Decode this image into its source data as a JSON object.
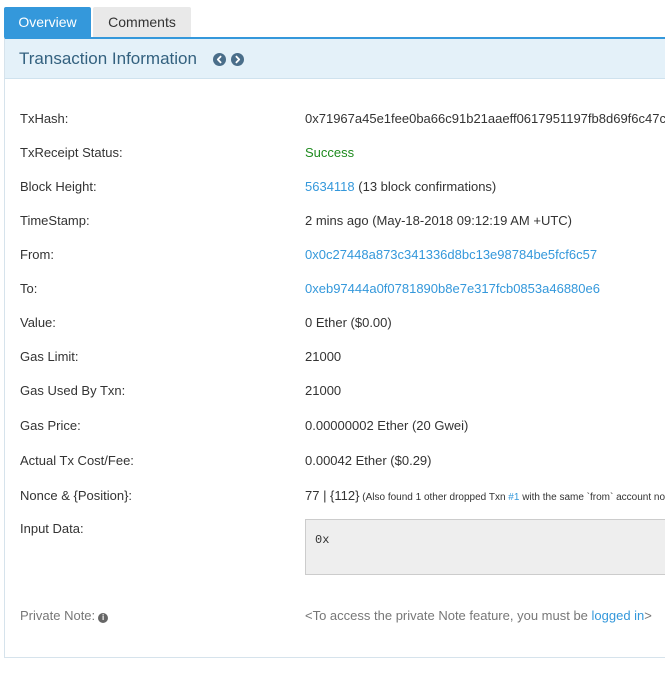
{
  "tabs": [
    {
      "label": "Overview",
      "active": true
    },
    {
      "label": "Comments",
      "active": false
    }
  ],
  "panel": {
    "title": "Transaction Information",
    "prev_icon": "chevron-left-circle-icon",
    "next_icon": "chevron-right-circle-icon"
  },
  "fields": {
    "txhash": {
      "label": "TxHash:",
      "value": "0x71967a45e1fee0ba66c91b21aaeff0617951197fb8d69f6c47c"
    },
    "status": {
      "label": "TxReceipt Status:",
      "value": "Success"
    },
    "block": {
      "label": "Block Height:",
      "block_number": "5634118",
      "confirmations": " (13 block confirmations)"
    },
    "timestamp": {
      "label": "TimeStamp:",
      "value": "2 mins ago (May-18-2018 09:12:19 AM +UTC)"
    },
    "from": {
      "label": "From:",
      "value": "0x0c27448a873c341336d8bc13e98784be5fcf6c57"
    },
    "to": {
      "label": "To:",
      "value": "0xeb97444a0f0781890b8e7e317fcb0853a46880e6"
    },
    "value": {
      "label": "Value:",
      "value": "0 Ether ($0.00)"
    },
    "gas_limit": {
      "label": "Gas Limit:",
      "value": "21000"
    },
    "gas_used": {
      "label": "Gas Used By Txn:",
      "value": "21000"
    },
    "gas_price": {
      "label": "Gas Price:",
      "value": "0.00000002 Ether (20 Gwei)"
    },
    "tx_cost": {
      "label": "Actual Tx Cost/Fee:",
      "value": "0.00042 Ether ($0.29)"
    },
    "nonce": {
      "label": "Nonce & {Position}:",
      "value": "77 | {112}",
      "note_prefix": " (Also found 1 other dropped Txn ",
      "note_link": "#1",
      "note_suffix": " with the same `from` account no"
    },
    "input": {
      "label": "Input Data:",
      "value": "0x"
    },
    "private_note": {
      "label": "Private Note:",
      "info_icon": "info-circle-icon",
      "text_prefix": "<To access the private Note feature, you must be ",
      "link": "logged in",
      "text_suffix": ">"
    }
  },
  "colors": {
    "accent": "#3498db",
    "header_bg": "#e4f1f9",
    "title": "#33617f",
    "success": "#1e8a1e"
  }
}
